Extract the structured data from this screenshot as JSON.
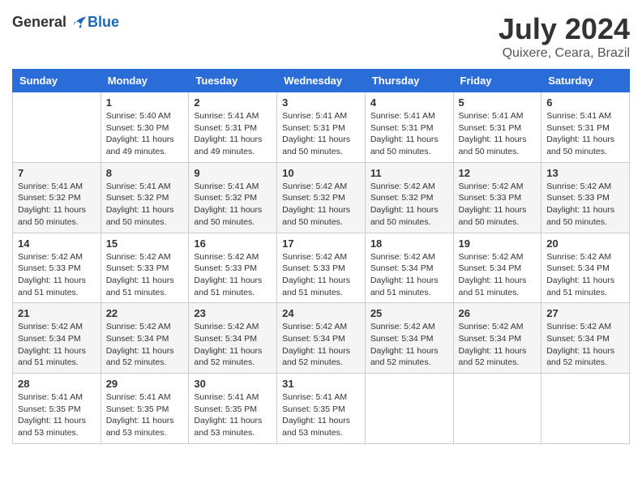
{
  "header": {
    "logo_general": "General",
    "logo_blue": "Blue",
    "title": "July 2024",
    "location": "Quixere, Ceara, Brazil"
  },
  "weekdays": [
    "Sunday",
    "Monday",
    "Tuesday",
    "Wednesday",
    "Thursday",
    "Friday",
    "Saturday"
  ],
  "weeks": [
    [
      {
        "day": "",
        "info": ""
      },
      {
        "day": "1",
        "info": "Sunrise: 5:40 AM\nSunset: 5:30 PM\nDaylight: 11 hours\nand 49 minutes."
      },
      {
        "day": "2",
        "info": "Sunrise: 5:41 AM\nSunset: 5:31 PM\nDaylight: 11 hours\nand 49 minutes."
      },
      {
        "day": "3",
        "info": "Sunrise: 5:41 AM\nSunset: 5:31 PM\nDaylight: 11 hours\nand 50 minutes."
      },
      {
        "day": "4",
        "info": "Sunrise: 5:41 AM\nSunset: 5:31 PM\nDaylight: 11 hours\nand 50 minutes."
      },
      {
        "day": "5",
        "info": "Sunrise: 5:41 AM\nSunset: 5:31 PM\nDaylight: 11 hours\nand 50 minutes."
      },
      {
        "day": "6",
        "info": "Sunrise: 5:41 AM\nSunset: 5:31 PM\nDaylight: 11 hours\nand 50 minutes."
      }
    ],
    [
      {
        "day": "7",
        "info": "Sunrise: 5:41 AM\nSunset: 5:32 PM\nDaylight: 11 hours\nand 50 minutes."
      },
      {
        "day": "8",
        "info": "Sunrise: 5:41 AM\nSunset: 5:32 PM\nDaylight: 11 hours\nand 50 minutes."
      },
      {
        "day": "9",
        "info": "Sunrise: 5:41 AM\nSunset: 5:32 PM\nDaylight: 11 hours\nand 50 minutes."
      },
      {
        "day": "10",
        "info": "Sunrise: 5:42 AM\nSunset: 5:32 PM\nDaylight: 11 hours\nand 50 minutes."
      },
      {
        "day": "11",
        "info": "Sunrise: 5:42 AM\nSunset: 5:32 PM\nDaylight: 11 hours\nand 50 minutes."
      },
      {
        "day": "12",
        "info": "Sunrise: 5:42 AM\nSunset: 5:33 PM\nDaylight: 11 hours\nand 50 minutes."
      },
      {
        "day": "13",
        "info": "Sunrise: 5:42 AM\nSunset: 5:33 PM\nDaylight: 11 hours\nand 50 minutes."
      }
    ],
    [
      {
        "day": "14",
        "info": "Sunrise: 5:42 AM\nSunset: 5:33 PM\nDaylight: 11 hours\nand 51 minutes."
      },
      {
        "day": "15",
        "info": "Sunrise: 5:42 AM\nSunset: 5:33 PM\nDaylight: 11 hours\nand 51 minutes."
      },
      {
        "day": "16",
        "info": "Sunrise: 5:42 AM\nSunset: 5:33 PM\nDaylight: 11 hours\nand 51 minutes."
      },
      {
        "day": "17",
        "info": "Sunrise: 5:42 AM\nSunset: 5:33 PM\nDaylight: 11 hours\nand 51 minutes."
      },
      {
        "day": "18",
        "info": "Sunrise: 5:42 AM\nSunset: 5:34 PM\nDaylight: 11 hours\nand 51 minutes."
      },
      {
        "day": "19",
        "info": "Sunrise: 5:42 AM\nSunset: 5:34 PM\nDaylight: 11 hours\nand 51 minutes."
      },
      {
        "day": "20",
        "info": "Sunrise: 5:42 AM\nSunset: 5:34 PM\nDaylight: 11 hours\nand 51 minutes."
      }
    ],
    [
      {
        "day": "21",
        "info": "Sunrise: 5:42 AM\nSunset: 5:34 PM\nDaylight: 11 hours\nand 51 minutes."
      },
      {
        "day": "22",
        "info": "Sunrise: 5:42 AM\nSunset: 5:34 PM\nDaylight: 11 hours\nand 52 minutes."
      },
      {
        "day": "23",
        "info": "Sunrise: 5:42 AM\nSunset: 5:34 PM\nDaylight: 11 hours\nand 52 minutes."
      },
      {
        "day": "24",
        "info": "Sunrise: 5:42 AM\nSunset: 5:34 PM\nDaylight: 11 hours\nand 52 minutes."
      },
      {
        "day": "25",
        "info": "Sunrise: 5:42 AM\nSunset: 5:34 PM\nDaylight: 11 hours\nand 52 minutes."
      },
      {
        "day": "26",
        "info": "Sunrise: 5:42 AM\nSunset: 5:34 PM\nDaylight: 11 hours\nand 52 minutes."
      },
      {
        "day": "27",
        "info": "Sunrise: 5:42 AM\nSunset: 5:34 PM\nDaylight: 11 hours\nand 52 minutes."
      }
    ],
    [
      {
        "day": "28",
        "info": "Sunrise: 5:41 AM\nSunset: 5:35 PM\nDaylight: 11 hours\nand 53 minutes."
      },
      {
        "day": "29",
        "info": "Sunrise: 5:41 AM\nSunset: 5:35 PM\nDaylight: 11 hours\nand 53 minutes."
      },
      {
        "day": "30",
        "info": "Sunrise: 5:41 AM\nSunset: 5:35 PM\nDaylight: 11 hours\nand 53 minutes."
      },
      {
        "day": "31",
        "info": "Sunrise: 5:41 AM\nSunset: 5:35 PM\nDaylight: 11 hours\nand 53 minutes."
      },
      {
        "day": "",
        "info": ""
      },
      {
        "day": "",
        "info": ""
      },
      {
        "day": "",
        "info": ""
      }
    ]
  ]
}
